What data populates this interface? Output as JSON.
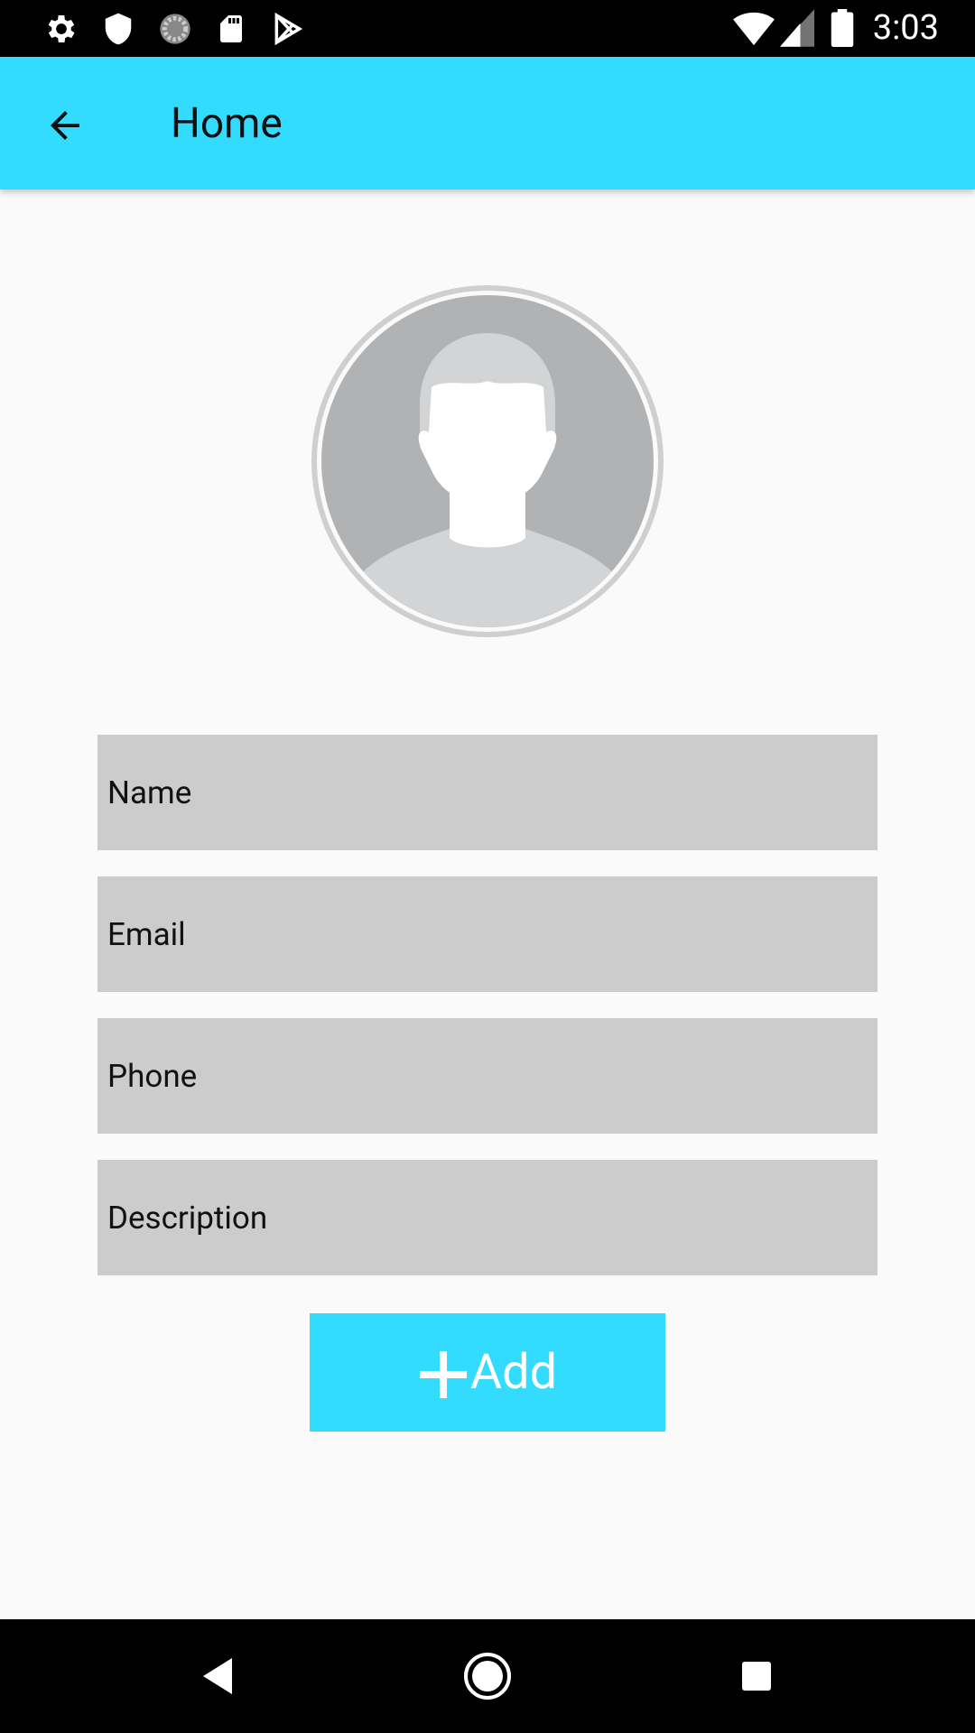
{
  "status_bar": {
    "time": "3:03",
    "left_icons": [
      "settings-icon",
      "shield-icon",
      "sync-icon",
      "sd-card-icon",
      "play-store-icon"
    ],
    "right_icons": [
      "wifi-icon",
      "cell-signal-icon",
      "battery-icon"
    ]
  },
  "app_bar": {
    "title": "Home",
    "back_icon": "arrow-back-icon",
    "color": "#33dbff"
  },
  "avatar": {
    "icon": "default-avatar-icon"
  },
  "form": {
    "name_placeholder": "Name",
    "email_placeholder": "Email",
    "phone_placeholder": "Phone",
    "description_placeholder": "Description"
  },
  "add_button": {
    "label": "Add",
    "icon": "plus-icon",
    "color": "#33dbff"
  },
  "nav_bar": {
    "icons": [
      "back-triangle-icon",
      "home-circle-icon",
      "recents-square-icon"
    ]
  }
}
